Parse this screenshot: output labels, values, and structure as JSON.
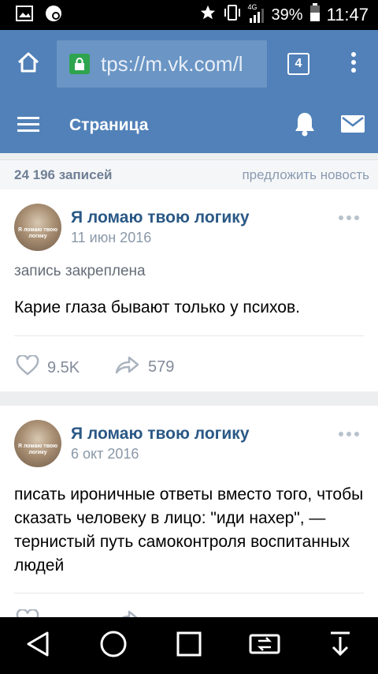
{
  "status_bar": {
    "battery_percent": "39%",
    "time": "11:47",
    "signal_label": "4G",
    "icons": [
      "image-icon",
      "sync-icon",
      "star-icon",
      "vibrate-icon",
      "signal-icon",
      "battery-icon"
    ]
  },
  "browser": {
    "url": "tps://m.vk.com/l",
    "tab_count": "4",
    "icons": [
      "home-icon",
      "lock-icon",
      "tabs-icon",
      "overflow-menu-icon"
    ]
  },
  "header": {
    "title": "Страница",
    "icons": [
      "hamburger-menu-icon",
      "bell-icon",
      "mail-icon"
    ]
  },
  "counter": {
    "records": "24 196 записей",
    "suggest": "предложить новость"
  },
  "posts": [
    {
      "author": "Я ломаю твою логику",
      "avatar_caption": "Я ломаю твою логику",
      "date": "11 июн 2016",
      "pinned": "запись закреплена",
      "text": "Карие глаза бывают только у психов.",
      "likes": "9.5K",
      "shares": "579"
    },
    {
      "author": "Я ломаю твою логику",
      "avatar_caption": "Я ломаю твою логику",
      "date": "6 окт 2016",
      "text": "писать ироничные ответы вместо того, чтобы сказать человеку в лицо: \"иди нахер\", — тернистый путь самоконтроля воспитанных людей"
    }
  ],
  "colors": {
    "vk_blue": "#5181b8",
    "author_blue": "#2a5885",
    "lock_green": "#2ea44f",
    "background": "#edeef0"
  },
  "navbar": {
    "icons": [
      "back-icon",
      "home-circle-icon",
      "recents-icon",
      "screen-switch-icon",
      "download-icon"
    ]
  }
}
